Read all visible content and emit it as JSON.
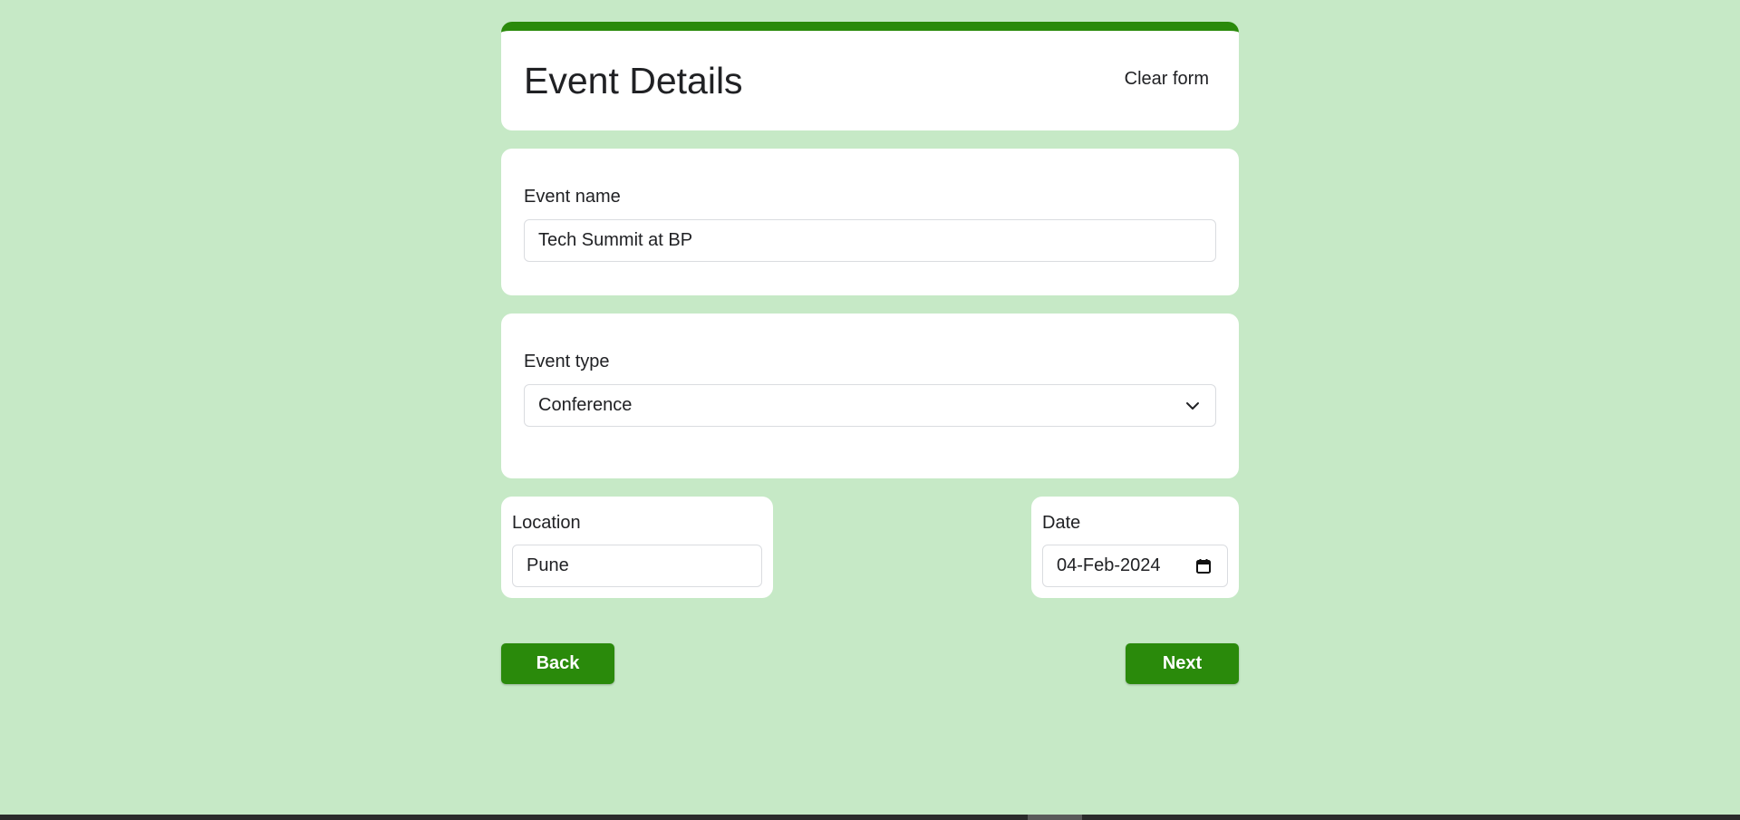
{
  "header": {
    "title": "Event Details",
    "clear_label": "Clear form",
    "accent_color": "#2a8a0b"
  },
  "event_name": {
    "label": "Event name",
    "value": "Tech Summit at BP"
  },
  "event_type": {
    "label": "Event type",
    "selected": "Conference"
  },
  "location": {
    "label": "Location",
    "value": "Pune"
  },
  "date": {
    "label": "Date",
    "value": "04-Feb-2024"
  },
  "navigation": {
    "back_label": "Back",
    "next_label": "Next"
  },
  "colors": {
    "background": "#c6e9c6",
    "button": "#2a8a0b",
    "card": "#ffffff"
  }
}
